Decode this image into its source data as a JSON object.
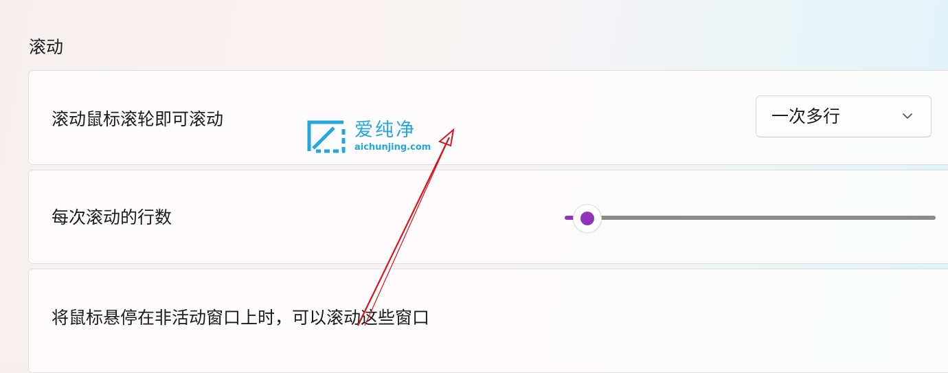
{
  "section": {
    "title": "滚动"
  },
  "settings": {
    "scroll_wheel": {
      "label": "滚动鼠标滚轮即可滚动",
      "dropdown_value": "一次多行"
    },
    "lines_per_scroll": {
      "label": "每次滚动的行数",
      "slider_level": 0.01
    },
    "inactive_scroll": {
      "label": "将鼠标悬停在非活动窗口上时，可以滚动这些窗口"
    }
  },
  "watermark": {
    "title": "爱纯净",
    "url": "aichunjing.com"
  },
  "colors": {
    "accent": "#9033b8",
    "annotation_arrow": "#d8131b",
    "watermark": "#23a7dc"
  }
}
